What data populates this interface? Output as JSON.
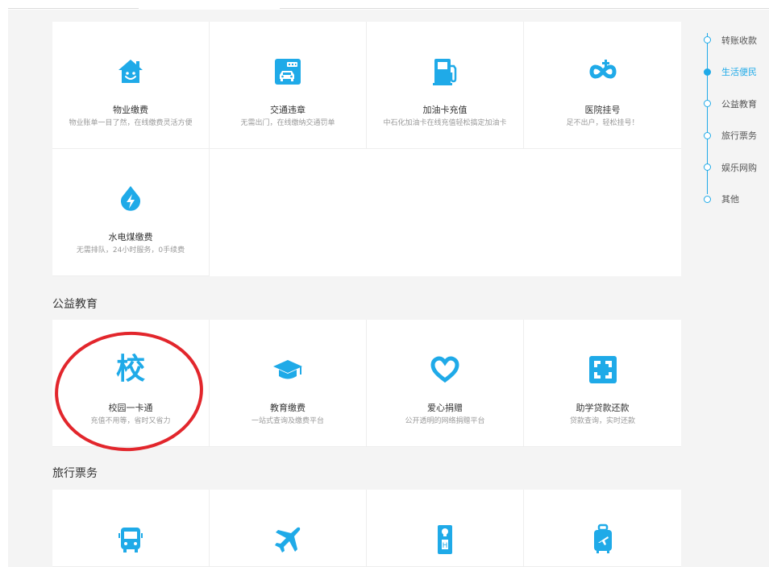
{
  "colors": {
    "accent": "#1faae8",
    "annotation": "#e2262c"
  },
  "life_services": [
    {
      "title": "物业缴费",
      "desc": "物业账单一目了然，在线缴费灵活方便",
      "icon": "house-smile-icon"
    },
    {
      "title": "交通违章",
      "desc": "无需出门，在线缴纳交通罚单",
      "icon": "traffic-car-icon"
    },
    {
      "title": "加油卡充值",
      "desc": "中石化加油卡在线充值轻松搞定加油卡",
      "icon": "fuel-pump-icon"
    },
    {
      "title": "医院挂号",
      "desc": "足不出户，轻松挂号！",
      "icon": "hospital-cross-icon"
    },
    {
      "title": "水电煤缴费",
      "desc": "无需排队，24小时服务，0手续费",
      "icon": "water-drop-bolt-icon"
    }
  ],
  "education": {
    "title": "公益教育",
    "items": [
      {
        "title": "校园一卡通",
        "desc": "充值不用等，省时又省力",
        "icon": "campus-char-icon",
        "glyph": "校"
      },
      {
        "title": "教育缴费",
        "desc": "一站式查询及缴费平台",
        "icon": "graduation-cap-icon"
      },
      {
        "title": "爱心捐赠",
        "desc": "公开透明的网络捐赠平台",
        "icon": "heart-icon"
      },
      {
        "title": "助学贷款还款",
        "desc": "贷款查询，实时还款",
        "icon": "loan-square-icon"
      }
    ]
  },
  "travel": {
    "title": "旅行票务",
    "items": [
      {
        "icon": "bus-icon"
      },
      {
        "icon": "airplane-icon"
      },
      {
        "icon": "hotel-tag-icon"
      },
      {
        "icon": "luggage-icon"
      }
    ]
  },
  "side_nav": [
    {
      "label": "转账收款",
      "active": false
    },
    {
      "label": "生活便民",
      "active": true
    },
    {
      "label": "公益教育",
      "active": false
    },
    {
      "label": "旅行票务",
      "active": false
    },
    {
      "label": "娱乐网购",
      "active": false
    },
    {
      "label": "其他",
      "active": false
    }
  ]
}
